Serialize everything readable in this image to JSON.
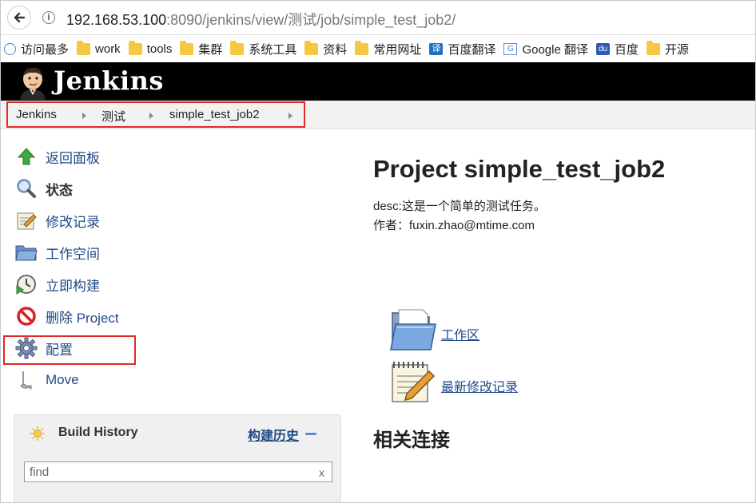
{
  "browser": {
    "url_host": "192.168.53.100",
    "url_rest": ":8090/jenkins/view/测试/job/simple_test_job2/",
    "bookmarks": [
      {
        "label": "访问最多",
        "icon": "visited-icon"
      },
      {
        "label": "work",
        "icon": "folder-icon"
      },
      {
        "label": "tools",
        "icon": "folder-icon"
      },
      {
        "label": "集群",
        "icon": "folder-icon"
      },
      {
        "label": "系统工具",
        "icon": "folder-icon"
      },
      {
        "label": "资料",
        "icon": "folder-icon"
      },
      {
        "label": "常用网址",
        "icon": "folder-icon"
      },
      {
        "label": "百度翻译",
        "icon": "fanyi-icon",
        "glyph": "译"
      },
      {
        "label": "Google 翻译",
        "icon": "google-translate-icon",
        "glyph": "G"
      },
      {
        "label": "百度",
        "icon": "baidu-icon",
        "glyph": "du"
      },
      {
        "label": "开源",
        "icon": "folder-icon"
      }
    ]
  },
  "header": {
    "title": "Jenkins"
  },
  "breadcrumb": {
    "items": [
      "Jenkins",
      "测试",
      "simple_test_job2"
    ]
  },
  "sidebar": {
    "tasks": [
      {
        "label": "返回面板",
        "icon": "up-arrow-icon"
      },
      {
        "label": "状态",
        "icon": "search-icon"
      },
      {
        "label": "修改记录",
        "icon": "notepad-icon"
      },
      {
        "label": "工作空间",
        "icon": "folder-icon"
      },
      {
        "label": "立即构建",
        "icon": "clock-play-icon"
      },
      {
        "label": "删除 Project",
        "icon": "no-entry-icon"
      },
      {
        "label": "配置",
        "icon": "gear-icon"
      },
      {
        "label": "Move",
        "icon": "mover-icon"
      }
    ]
  },
  "build_history": {
    "title": "Build History",
    "trend_link": "构建历史",
    "search_value": "find",
    "clear_label": "x"
  },
  "main": {
    "title": "Project simple_test_job2",
    "desc_line1": "desc:这是一个简单的测试任务。",
    "desc_line2": "作者：fuxin.zhao@mtime.com",
    "links": [
      {
        "label": "工作区",
        "icon": "folder-icon"
      },
      {
        "label": "最新修改记录",
        "icon": "notepad-icon"
      }
    ],
    "related_heading": "相关连接"
  },
  "colors": {
    "accent": "#204a87",
    "highlight": "#e02a2a"
  }
}
